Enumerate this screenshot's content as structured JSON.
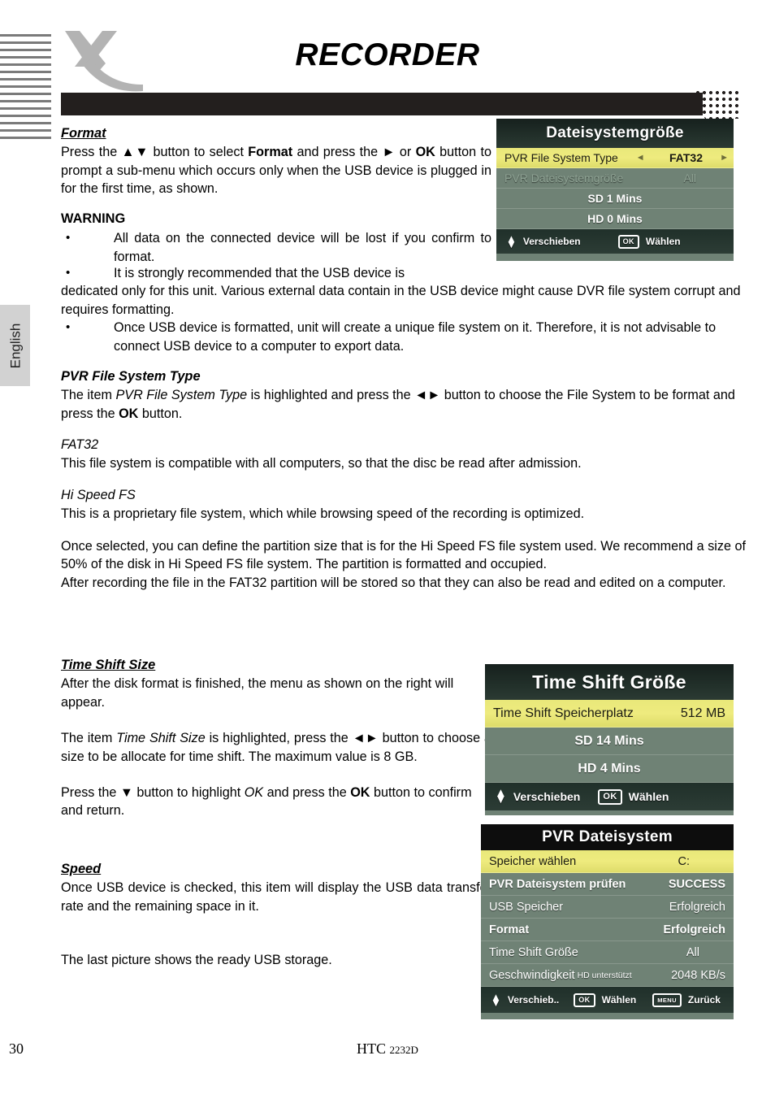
{
  "header": {
    "title": "RECORDER",
    "logo": "xoro-x-logo"
  },
  "sidebar": {
    "language_tab": "English"
  },
  "content": {
    "format": {
      "heading": "Format",
      "body_1": "Press the ",
      "body_2": " button to select ",
      "format_bold": "Format",
      "body_3": " and press the ",
      "body_4": " or ",
      "ok_bold": "OK",
      "body_5": " button to prompt a sub-menu which occurs only when the USB device is plugged in for the first time, as shown."
    },
    "warning": {
      "heading": "WARNING",
      "bullet": "•",
      "items": [
        "All data on the connected device will be lost if you confirm to format.",
        "It is strongly recommended that the USB device is dedicated only for this unit. Various external data contain in the USB device might cause DVR file system corrupt and requires formatting.",
        "Once USB device is formatted, unit will create a unique file system on it. Therefore, it is not advisable to connect USB device to a computer to export data."
      ],
      "item2_line1": "It is strongly recommended that the USB device is",
      "item2_rest": "dedicated only for this unit. Various external data contain in the USB device might cause DVR file system corrupt and requires formatting."
    },
    "pvr_file_system_type": {
      "heading": "PVR File System Type",
      "p1_a": "The item ",
      "p1_italic": "PVR File System Type",
      "p1_b": " is highlighted and press the ",
      "p1_c": " button to choose the File System to be format and press the ",
      "p1_ok": "OK",
      "p1_d": " button."
    },
    "fat32": {
      "heading": "FAT32",
      "body": "This file system is compatible with all computers, so that the disc be read after admission."
    },
    "hi_speed_fs": {
      "heading": "Hi Speed FS",
      "body": "This is a proprietary file system, which while browsing speed of the recording is optimized."
    },
    "partition": {
      "p1": "Once selected, you can define the partition size that is for the Hi Speed FS file system used. We recommend a size of 50% of the disk in Hi Speed FS file system. The partition is formatted and occupied.",
      "p2": "After recording the file in the FAT32 partition will be stored so that they can also be read and edited on a computer."
    },
    "time_shift_size": {
      "heading": "Time Shift Size",
      "p1": "After the disk format is finished, the menu as shown on the right will appear.",
      "p2_a": "The item ",
      "p2_italic": "Time Shift Size",
      "p2_b": " is highlighted, press the ",
      "p2_c": " button to choose a size to be allocate for time shift. The maximum value is 8 GB.",
      "p3_a": "Press the ",
      "p3_arrow": "▼",
      "p3_b": " button to highlight ",
      "p3_ok_italic": "OK",
      "p3_c": " and press the ",
      "p3_ok_bold": "OK",
      "p3_d": " button to confirm and return."
    },
    "speed": {
      "heading": "Speed",
      "p1": "Once USB device is checked, this item will display the USB data transfer rate and the remaining space in it.",
      "p2": "The last picture shows the ready USB storage."
    }
  },
  "glyphs": {
    "up_down": "▲▼",
    "right": "►",
    "left_right": "◄►",
    "up": "▲",
    "down": "▼"
  },
  "osd_screens": [
    {
      "id": "dateisystemgroesse",
      "title": "Dateisystemgröße",
      "rows": [
        {
          "label": "PVR File System Type",
          "value": "FAT32",
          "state": "highlighted",
          "has_arrows": true
        },
        {
          "label": "PVR Dateisystemgröße",
          "value": "All",
          "state": "dimmed",
          "has_arrows": false
        },
        {
          "label": "SD 1 Mins",
          "value": "",
          "state": "center",
          "has_arrows": false
        },
        {
          "label": "HD 0 Mins",
          "value": "",
          "state": "center",
          "has_arrows": false
        }
      ],
      "footer": [
        {
          "icon": "up-down-arrows",
          "key": "",
          "label": "Verschieben"
        },
        {
          "icon": "",
          "key": "OK",
          "label": "Wählen"
        }
      ]
    },
    {
      "id": "timeshiftgroesse",
      "title": "Time Shift Größe",
      "rows": [
        {
          "label": "Time Shift Speicherplatz",
          "value": "512 MB",
          "state": "highlighted",
          "has_arrows": false
        },
        {
          "label": "SD 14 Mins",
          "value": "",
          "state": "center",
          "has_arrows": false
        },
        {
          "label": "HD 4 Mins",
          "value": "",
          "state": "center",
          "has_arrows": false
        }
      ],
      "footer": [
        {
          "icon": "up-down-arrows",
          "key": "",
          "label": "Verschieben"
        },
        {
          "icon": "",
          "key": "OK",
          "label": "Wählen"
        }
      ]
    },
    {
      "id": "pvrdateisystem",
      "title": "PVR Dateisystem",
      "rows": [
        {
          "label": "Speicher wählen",
          "value": "C:",
          "state": "highlighted",
          "has_arrows": false
        },
        {
          "label": "PVR Dateisystem prüfen",
          "value": "SUCCESS",
          "state": "bold",
          "has_arrows": false
        },
        {
          "label": "USB Speicher",
          "value": "Erfolgreich",
          "state": "normal",
          "has_arrows": false
        },
        {
          "label": "Format",
          "value": "Erfolgreich",
          "state": "bold",
          "has_arrows": false
        },
        {
          "label": "Time Shift Größe",
          "value": "All",
          "state": "normal",
          "has_arrows": false
        },
        {
          "label": "Geschwindigkeit",
          "sub": "HD unterstützt",
          "value": "2048 KB/s",
          "state": "normal",
          "has_arrows": false
        }
      ],
      "footer": [
        {
          "icon": "up-down-arrows",
          "key": "",
          "label": "Verschieb.."
        },
        {
          "icon": "",
          "key": "OK",
          "label": "Wählen"
        },
        {
          "icon": "",
          "key": "MENU",
          "label": "Zurück"
        }
      ]
    }
  ],
  "footer": {
    "page_number": "30",
    "model_prefix": "HTC ",
    "model_suffix": "2232D"
  },
  "colors": {
    "highlight_yellow": "#e9e87a",
    "osd_green": "#6f8275",
    "title_dark": "#16201d",
    "bar_black": "#231f1e",
    "logo_gray": "#b3b3b3",
    "tab_gray": "#d2d2d2"
  }
}
